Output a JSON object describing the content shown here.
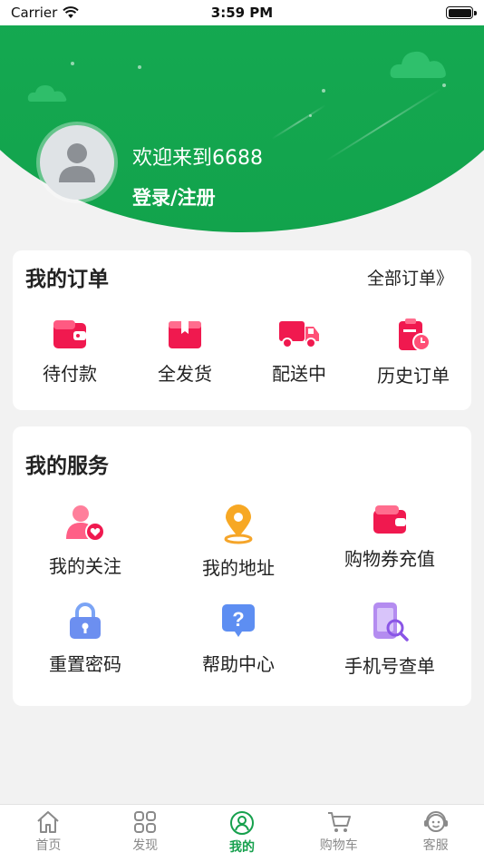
{
  "status_bar": {
    "carrier": "Carrier",
    "time": "3:59 PM"
  },
  "profile": {
    "welcome": "欢迎来到6688",
    "login_label": "登录/注册"
  },
  "orders": {
    "title": "我的订单",
    "all_label": "全部订单》",
    "items": [
      {
        "label": "待付款",
        "icon": "wallet-icon"
      },
      {
        "label": "全发货",
        "icon": "package-icon"
      },
      {
        "label": "配送中",
        "icon": "truck-icon"
      },
      {
        "label": "历史订单",
        "icon": "clipboard-clock-icon"
      }
    ]
  },
  "services": {
    "title": "我的服务",
    "items": [
      {
        "label": "我的关注",
        "icon": "user-heart-icon"
      },
      {
        "label": "我的地址",
        "icon": "location-pin-icon"
      },
      {
        "label": "购物券充值",
        "icon": "wallet-icon"
      },
      {
        "label": "重置密码",
        "icon": "lock-icon"
      },
      {
        "label": "帮助中心",
        "icon": "question-icon"
      },
      {
        "label": "手机号查单",
        "icon": "phone-search-icon"
      }
    ]
  },
  "tabbar": {
    "items": [
      {
        "label": "首页",
        "icon": "home-icon",
        "active": false
      },
      {
        "label": "发现",
        "icon": "grid-icon",
        "active": false
      },
      {
        "label": "我的",
        "icon": "user-icon",
        "active": true
      },
      {
        "label": "购物车",
        "icon": "cart-icon",
        "active": false
      },
      {
        "label": "客服",
        "icon": "headset-icon",
        "active": false
      }
    ]
  },
  "colors": {
    "brand_green": "#14a850",
    "accent_red": "#f0194f",
    "tab_active": "#16a04d"
  }
}
